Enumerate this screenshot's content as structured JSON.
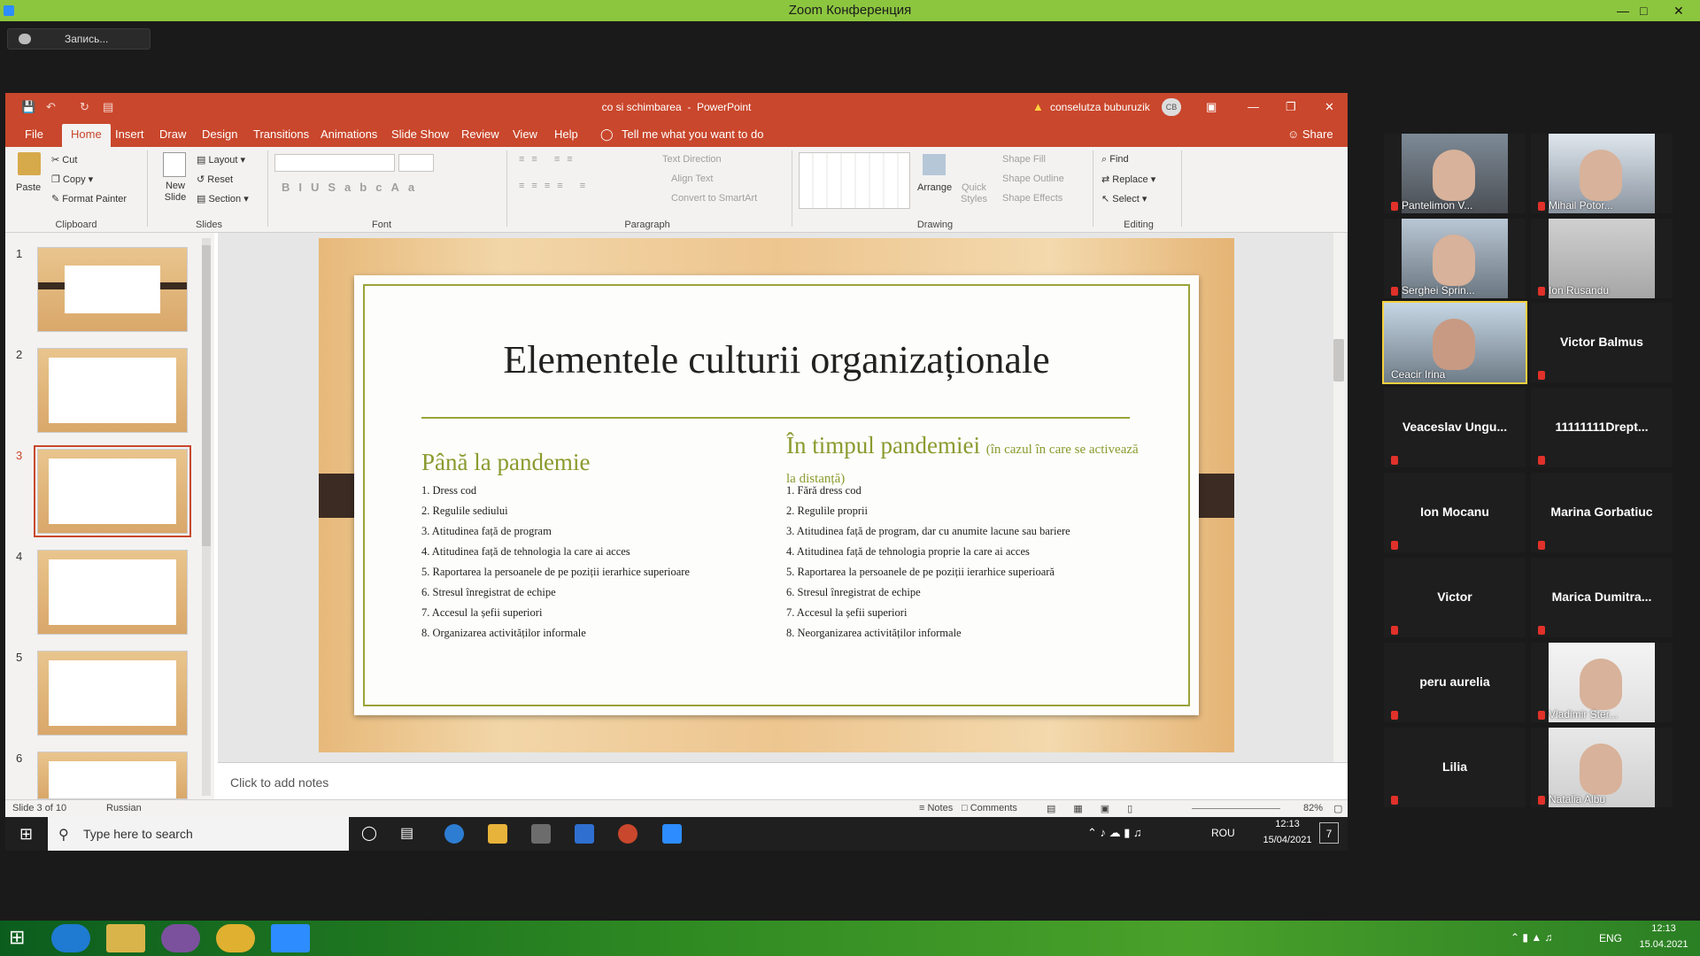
{
  "zoom": {
    "title": "Zoom Конференция",
    "record_label": "Запись..."
  },
  "ppt": {
    "filename": "co si schimbarea",
    "app": "PowerPoint",
    "user": "conselutza buburuzik",
    "user_initials": "CB",
    "tabs": [
      "File",
      "Home",
      "Insert",
      "Draw",
      "Design",
      "Transitions",
      "Animations",
      "Slide Show",
      "Review",
      "View",
      "Help"
    ],
    "tell_me": "Tell me what you want to do",
    "share": "Share",
    "ribbon": {
      "paste": "Paste",
      "cut": "Cut",
      "copy": "Copy",
      "format_painter": "Format Painter",
      "clipboard": "Clipboard",
      "new_slide": "New Slide",
      "layout": "Layout",
      "reset": "Reset",
      "section": "Section",
      "slides": "Slides",
      "font": "Font",
      "text_direction": "Text Direction",
      "align_text": "Align Text",
      "convert_smartart": "Convert to SmartArt",
      "paragraph": "Paragraph",
      "arrange": "Arrange",
      "quick_styles": "Quick Styles",
      "shape_fill": "Shape Fill",
      "shape_outline": "Shape Outline",
      "shape_effects": "Shape Effects",
      "drawing": "Drawing",
      "find": "Find",
      "replace": "Replace",
      "select": "Select",
      "editing": "Editing"
    },
    "thumb_numbers": [
      "1",
      "2",
      "3",
      "4",
      "5",
      "6"
    ],
    "slide": {
      "title": "Elementele culturii organizaționale",
      "left_heading": "Până la pandemie",
      "right_heading": "În timpul pandemiei",
      "right_note": "(în cazul în care se activează la distanță)",
      "left_items": [
        "1. Dress cod",
        "2. Regulile sediului",
        "3. Atitudinea față de program",
        "4. Atitudinea față de tehnologia la care ai acces",
        "5. Raportarea la persoanele de pe poziții ierarhice superioare",
        "6. Stresul înregistrat de echipe",
        "7. Accesul la șefii superiori",
        "8. Organizarea activităților informale"
      ],
      "right_items": [
        "1. Fără dress cod",
        "2. Regulile proprii",
        "3. Atitudinea față de program, dar cu anumite lacune sau bariere",
        "4. Atitudinea față de tehnologia proprie la care ai acces",
        "5. Raportarea la persoanele de pe poziții ierarhice superioară",
        "6. Stresul înregistrat de echipe",
        "7. Accesul la șefii superiori",
        "8. Neorganizarea activităților informale"
      ]
    },
    "notes_placeholder": "Click to add notes",
    "status": {
      "slide": "Slide 3 of 10",
      "lang": "Russian",
      "notes": "Notes",
      "comments": "Comments",
      "zoom": "82%"
    }
  },
  "shared_taskbar": {
    "search": "Type here to search",
    "lang": "ROU",
    "time": "12:13",
    "date": "15/04/2021",
    "notif": "7"
  },
  "participants": [
    {
      "name": "Pantelimon V...",
      "video": true
    },
    {
      "name": "Mihail Potor...",
      "video": true
    },
    {
      "name": "Serghei Sprin...",
      "video": true
    },
    {
      "name": "Ion Rusandu",
      "video": true
    },
    {
      "name": "Ceacir Irina",
      "video": true,
      "active": true
    },
    {
      "name": "Victor Balmus",
      "video": false
    },
    {
      "name": "Veaceslav  Ungu...",
      "video": false
    },
    {
      "name": "11111111Drept...",
      "video": false
    },
    {
      "name": "Ion Mocanu",
      "video": false
    },
    {
      "name": "Marina Gorbatiuc",
      "video": false
    },
    {
      "name": "Victor",
      "video": false
    },
    {
      "name": "Marica  Dumitra...",
      "video": false
    },
    {
      "name": "peru aurelia",
      "video": false
    },
    {
      "name": "Vladimir Ster...",
      "video": true
    },
    {
      "name": "Lilia",
      "video": false
    },
    {
      "name": "Natalia Albu",
      "video": true
    }
  ],
  "host_taskbar": {
    "lang": "ENG",
    "time": "12:13",
    "date": "15.04.2021"
  }
}
